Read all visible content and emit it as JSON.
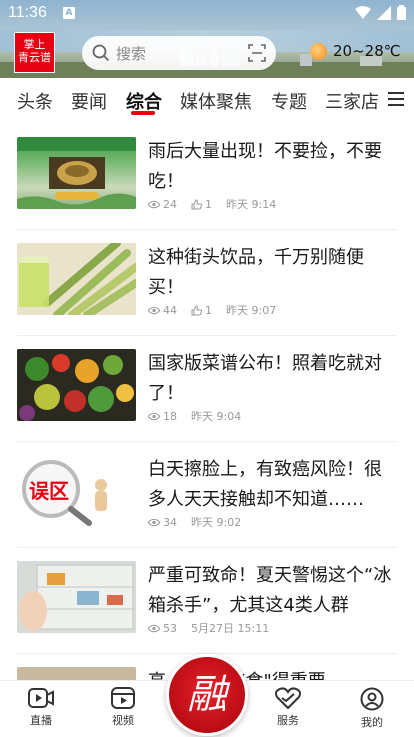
{
  "status": {
    "time": "11:36",
    "a_badge": "A"
  },
  "logo": {
    "line1": "掌上",
    "line2": "青云谱"
  },
  "search": {
    "placeholder": "搜索"
  },
  "weather": {
    "text": "20~28℃"
  },
  "tabs": [
    "头条",
    "要闻",
    "综合",
    "媒体聚焦",
    "专题",
    "三家店"
  ],
  "active_tab": "综合",
  "articles": [
    {
      "title": "雨后大量出现！不要捡，不要吃！",
      "views": "24",
      "likes": "1",
      "time": "昨天 9:14",
      "thumb": "mushroom-poster"
    },
    {
      "title": "这种街头饮品，千万别随便买！",
      "views": "44",
      "likes": "1",
      "time": "昨天 9:07",
      "thumb": "sugarcane-juice"
    },
    {
      "title": "国家版菜谱公布！照着吃就对了！",
      "views": "18",
      "likes": "",
      "time": "昨天 9:04",
      "thumb": "vegetables"
    },
    {
      "title": "白天擦脸上，有致癌风险！很多人天天接触却不知道……",
      "views": "34",
      "likes": "",
      "time": "昨天 9:02",
      "thumb": "magnifier-misconception",
      "thumb_text": "误区"
    },
    {
      "title": "严重可致命！夏天警惕这个“冰箱杀手”，尤其这4类人群",
      "views": "53",
      "likes": "",
      "time": "5月27日 15:11",
      "thumb": "refrigerator"
    },
    {
      "title": "高...党会\"挑食\"得重要",
      "views": "",
      "likes": "",
      "time": "",
      "thumb": "partial"
    }
  ],
  "bottom_nav": [
    {
      "label": "直播",
      "icon": "live-icon"
    },
    {
      "label": "视频",
      "icon": "video-icon"
    },
    {
      "label": "融",
      "icon": "center-logo"
    },
    {
      "label": "服务",
      "icon": "service-icon"
    },
    {
      "label": "我的",
      "icon": "profile-icon"
    }
  ],
  "colors": {
    "brand_red": "#e60012",
    "tab_underline": "#e60012"
  }
}
